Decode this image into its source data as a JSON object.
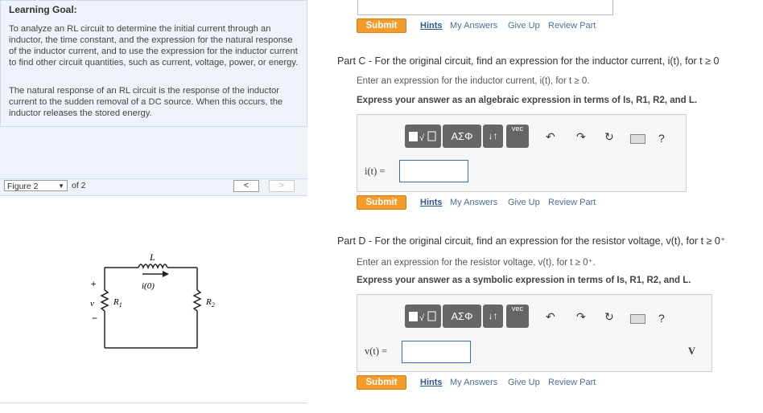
{
  "goal": {
    "title": "Learning Goal:",
    "p1": "To analyze an RL circuit to determine the initial current through an inductor, the time constant, and the expression for the natural response of the inductor current, and to use the expression for the inductor current to find other circuit quantities, such as current, voltage, power, or energy.",
    "p2": "The natural response of an RL circuit is the response of the inductor current to the sudden removal of a DC source. When this occurs, the inductor releases the stored energy."
  },
  "figure": {
    "selected": "Figure 2",
    "of": "of 2",
    "prev_icon": "<",
    "next_icon": ">",
    "labels": {
      "L": "L",
      "i0": "i(0)",
      "v": "v",
      "plus": "+",
      "minus": "−",
      "R1": "R",
      "R1sub": "1",
      "R2": "R",
      "R2sub": "2"
    }
  },
  "actions": {
    "submit": "Submit",
    "hints": "Hints",
    "my_answers": "My Answers",
    "give_up": "Give Up",
    "review": "Review Part"
  },
  "toolbar": {
    "vec": "vec",
    "greek": "ΑΣΦ",
    "arrows": "↓↑",
    "help": "?"
  },
  "partC": {
    "heading": "Part C - For the original circuit, find an expression for the inductor current, i(t), for t ≥ 0",
    "enter": "Enter an expression for the inductor current, i(t), for t ≥ 0.",
    "express": "Express your answer as an algebraic expression in terms of Is, R1, R2, and L.",
    "label": "i(t) =",
    "value": ""
  },
  "partD": {
    "heading": "Part D - For the original circuit, find an expression for the resistor voltage, v(t), for t ≥ 0⁺",
    "enter": "Enter an expression for the resistor voltage, v(t), for t ≥ 0⁺.",
    "express": "Express your answer as a symbolic expression in terms of Is, R1, R2, and L.",
    "label": "v(t) =",
    "value": "",
    "unit": "V"
  }
}
